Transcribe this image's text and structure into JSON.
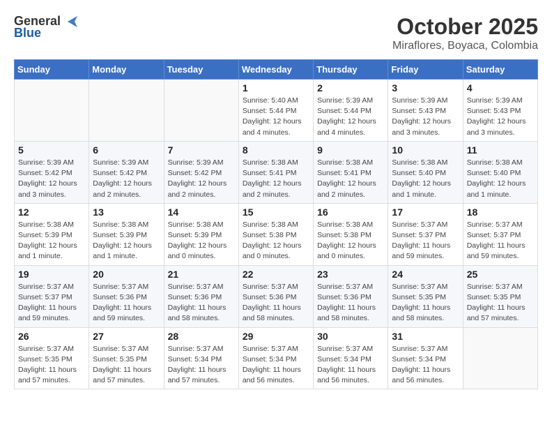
{
  "header": {
    "logo_general": "General",
    "logo_blue": "Blue",
    "month_year": "October 2025",
    "location": "Miraflores, Boyaca, Colombia"
  },
  "weekdays": [
    "Sunday",
    "Monday",
    "Tuesday",
    "Wednesday",
    "Thursday",
    "Friday",
    "Saturday"
  ],
  "weeks": [
    [
      {
        "day": "",
        "info": ""
      },
      {
        "day": "",
        "info": ""
      },
      {
        "day": "",
        "info": ""
      },
      {
        "day": "1",
        "info": "Sunrise: 5:40 AM\nSunset: 5:44 PM\nDaylight: 12 hours\nand 4 minutes."
      },
      {
        "day": "2",
        "info": "Sunrise: 5:39 AM\nSunset: 5:44 PM\nDaylight: 12 hours\nand 4 minutes."
      },
      {
        "day": "3",
        "info": "Sunrise: 5:39 AM\nSunset: 5:43 PM\nDaylight: 12 hours\nand 3 minutes."
      },
      {
        "day": "4",
        "info": "Sunrise: 5:39 AM\nSunset: 5:43 PM\nDaylight: 12 hours\nand 3 minutes."
      }
    ],
    [
      {
        "day": "5",
        "info": "Sunrise: 5:39 AM\nSunset: 5:42 PM\nDaylight: 12 hours\nand 3 minutes."
      },
      {
        "day": "6",
        "info": "Sunrise: 5:39 AM\nSunset: 5:42 PM\nDaylight: 12 hours\nand 2 minutes."
      },
      {
        "day": "7",
        "info": "Sunrise: 5:39 AM\nSunset: 5:42 PM\nDaylight: 12 hours\nand 2 minutes."
      },
      {
        "day": "8",
        "info": "Sunrise: 5:38 AM\nSunset: 5:41 PM\nDaylight: 12 hours\nand 2 minutes."
      },
      {
        "day": "9",
        "info": "Sunrise: 5:38 AM\nSunset: 5:41 PM\nDaylight: 12 hours\nand 2 minutes."
      },
      {
        "day": "10",
        "info": "Sunrise: 5:38 AM\nSunset: 5:40 PM\nDaylight: 12 hours\nand 1 minute."
      },
      {
        "day": "11",
        "info": "Sunrise: 5:38 AM\nSunset: 5:40 PM\nDaylight: 12 hours\nand 1 minute."
      }
    ],
    [
      {
        "day": "12",
        "info": "Sunrise: 5:38 AM\nSunset: 5:39 PM\nDaylight: 12 hours\nand 1 minute."
      },
      {
        "day": "13",
        "info": "Sunrise: 5:38 AM\nSunset: 5:39 PM\nDaylight: 12 hours\nand 1 minute."
      },
      {
        "day": "14",
        "info": "Sunrise: 5:38 AM\nSunset: 5:39 PM\nDaylight: 12 hours\nand 0 minutes."
      },
      {
        "day": "15",
        "info": "Sunrise: 5:38 AM\nSunset: 5:38 PM\nDaylight: 12 hours\nand 0 minutes."
      },
      {
        "day": "16",
        "info": "Sunrise: 5:38 AM\nSunset: 5:38 PM\nDaylight: 12 hours\nand 0 minutes."
      },
      {
        "day": "17",
        "info": "Sunrise: 5:37 AM\nSunset: 5:37 PM\nDaylight: 11 hours\nand 59 minutes."
      },
      {
        "day": "18",
        "info": "Sunrise: 5:37 AM\nSunset: 5:37 PM\nDaylight: 11 hours\nand 59 minutes."
      }
    ],
    [
      {
        "day": "19",
        "info": "Sunrise: 5:37 AM\nSunset: 5:37 PM\nDaylight: 11 hours\nand 59 minutes."
      },
      {
        "day": "20",
        "info": "Sunrise: 5:37 AM\nSunset: 5:36 PM\nDaylight: 11 hours\nand 59 minutes."
      },
      {
        "day": "21",
        "info": "Sunrise: 5:37 AM\nSunset: 5:36 PM\nDaylight: 11 hours\nand 58 minutes."
      },
      {
        "day": "22",
        "info": "Sunrise: 5:37 AM\nSunset: 5:36 PM\nDaylight: 11 hours\nand 58 minutes."
      },
      {
        "day": "23",
        "info": "Sunrise: 5:37 AM\nSunset: 5:36 PM\nDaylight: 11 hours\nand 58 minutes."
      },
      {
        "day": "24",
        "info": "Sunrise: 5:37 AM\nSunset: 5:35 PM\nDaylight: 11 hours\nand 58 minutes."
      },
      {
        "day": "25",
        "info": "Sunrise: 5:37 AM\nSunset: 5:35 PM\nDaylight: 11 hours\nand 57 minutes."
      }
    ],
    [
      {
        "day": "26",
        "info": "Sunrise: 5:37 AM\nSunset: 5:35 PM\nDaylight: 11 hours\nand 57 minutes."
      },
      {
        "day": "27",
        "info": "Sunrise: 5:37 AM\nSunset: 5:35 PM\nDaylight: 11 hours\nand 57 minutes."
      },
      {
        "day": "28",
        "info": "Sunrise: 5:37 AM\nSunset: 5:34 PM\nDaylight: 11 hours\nand 57 minutes."
      },
      {
        "day": "29",
        "info": "Sunrise: 5:37 AM\nSunset: 5:34 PM\nDaylight: 11 hours\nand 56 minutes."
      },
      {
        "day": "30",
        "info": "Sunrise: 5:37 AM\nSunset: 5:34 PM\nDaylight: 11 hours\nand 56 minutes."
      },
      {
        "day": "31",
        "info": "Sunrise: 5:37 AM\nSunset: 5:34 PM\nDaylight: 11 hours\nand 56 minutes."
      },
      {
        "day": "",
        "info": ""
      }
    ]
  ]
}
